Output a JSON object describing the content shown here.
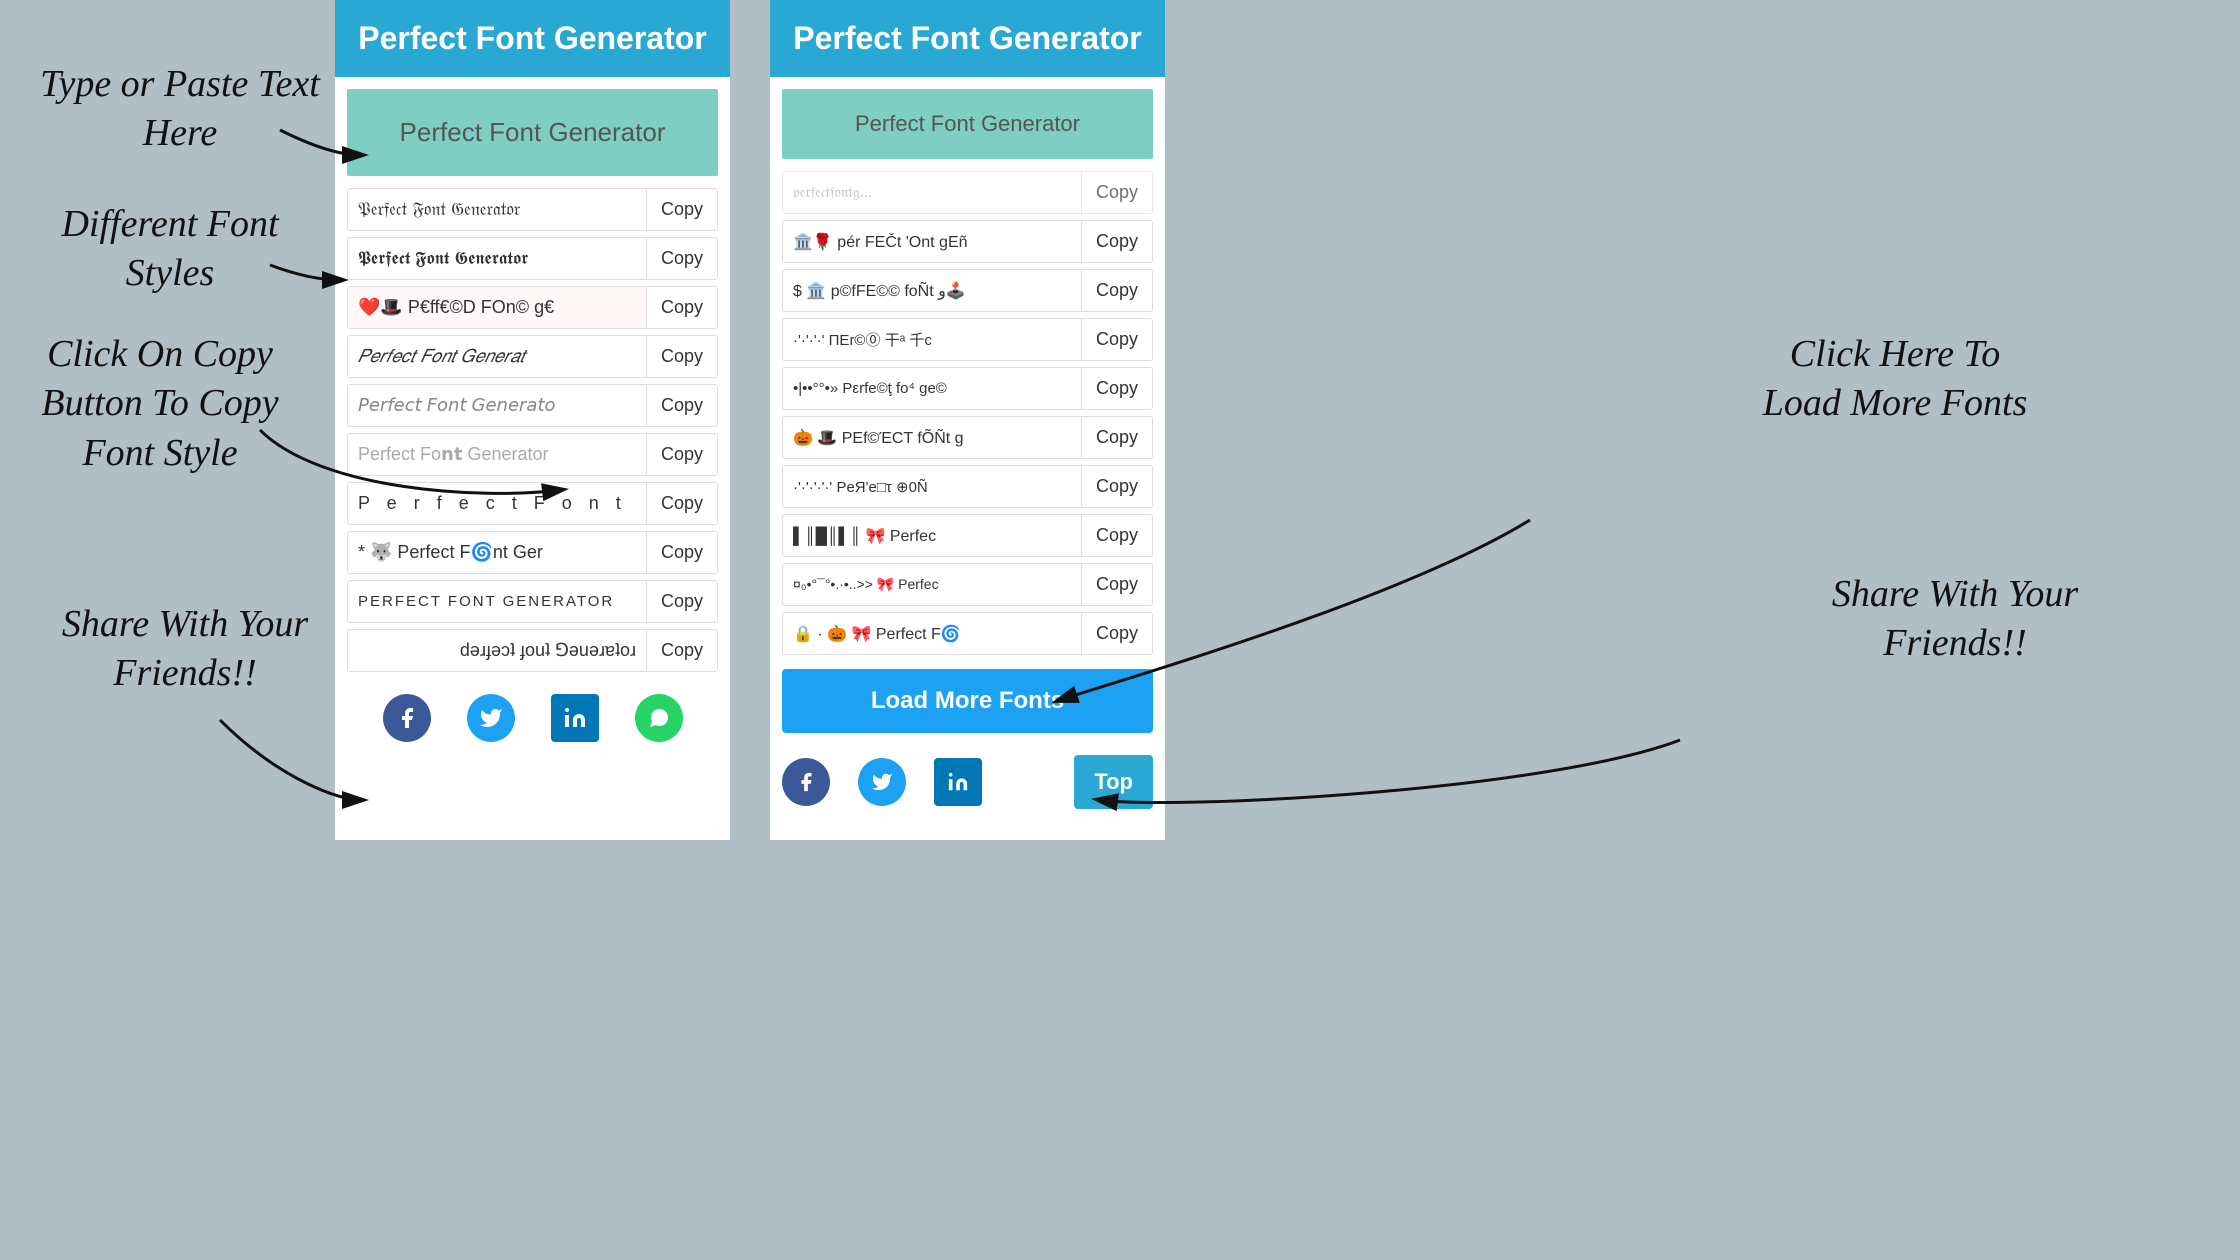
{
  "app": {
    "title": "Perfect Font Generator"
  },
  "annotations": {
    "type_paste": "Type or Paste Text\nHere",
    "diff_fonts": "Different Font\nStyles",
    "click_copy": "Click On Copy\nButton To Copy\nFont Style",
    "share": "Share With\nYour\nFriends!!",
    "load_more_label": "Click Here To\nLoad More\nFonts",
    "share_right": "Share With\nYour\nFriends!!"
  },
  "left_panel": {
    "header": "Perfect Font Generator",
    "input_placeholder": "Perfect Font Generator",
    "font_rows": [
      {
        "text": "𝔓𝔢𝔯𝔣𝔢𝔠𝔱 𝔉𝔬𝔫𝔱 𝔊𝔢𝔫𝔢𝔯𝔞𝔱𝔬𝔯",
        "copy": "Copy"
      },
      {
        "text": "𝕻𝖊𝖗𝖋𝖊𝖈𝖙 𝕱𝖔𝖓𝖙 𝕲𝖊𝖓𝖊𝖗𝖆𝖙𝖔𝖗",
        "copy": "Copy"
      },
      {
        "text": "❤️🎩 P€ff€©D FOn© g€",
        "copy": "Copy"
      },
      {
        "text": "𝑃𝑒𝑟𝑓𝑒𝑐𝑡 𝐹𝑜𝑛𝑡 𝐺𝑒𝑛𝑒𝑟𝑎𝑡",
        "copy": "Copy"
      },
      {
        "text": "𝘗𝘦𝘳𝘧𝘦𝘤𝘵 𝘍𝘰𝘯𝘵 𝘎𝘦𝘯𝘦𝘳𝘢𝘵𝘰",
        "copy": "Copy"
      },
      {
        "text": "Perfect Fo𝗻𝘁 Generator",
        "copy": "Copy"
      },
      {
        "text": "P e r f e c t  F o n t",
        "copy": "Copy"
      },
      {
        "text": "* 🐺 Perfect F🌀nt Ger",
        "copy": "Copy"
      },
      {
        "text": "PERFECT FONT GENERATOR",
        "copy": "Copy"
      },
      {
        "text": "ɹoʇɐɹǝuǝ⅁ ʇuoɟ ʇɔǝɟɹǝd",
        "copy": "Copy"
      }
    ],
    "social": [
      "facebook",
      "twitter",
      "linkedin",
      "whatsapp"
    ]
  },
  "right_panel": {
    "header": "Perfect Font Generator",
    "input_placeholder": "Perfect Font Generator",
    "font_rows": [
      {
        "text": "𝔭𝔢𝔯𝔣𝔢𝔠𝔱 𝔣𝔬𝔫𝔱 𝔤...",
        "copy": "Copy"
      },
      {
        "text": "🏛️🌹 pér FEČt 'Ont gEñ",
        "copy": "Copy"
      },
      {
        "text": "$ 🏛️ p©fFE©© foÑt ﻭ🕹️",
        "copy": "Copy"
      },
      {
        "text": "·'·'·'·' ΠΕr©⓪ 干ᵃ 千c",
        "copy": "Copy"
      },
      {
        "text": "•|••°°•» Ρεrfe©ţ fo⁴ ge©",
        "copy": "Copy"
      },
      {
        "text": "🎃 🎩 ΡΕf©ΈCT fÕÑt g",
        "copy": "Copy"
      },
      {
        "text": "·'·'·'·'·' PeЯ'е□τ ⊕0Ñ",
        "copy": "Copy"
      },
      {
        "text": "▌║█║▌║ 🎀 Perfec",
        "copy": "Copy"
      },
      {
        "text": "¤₀•°¯°•.·•..>> 🎀 Perfec",
        "copy": "Copy"
      },
      {
        "text": "🔒 · 🎃 🎀 Perfect F🌀",
        "copy": "Copy"
      }
    ],
    "load_more": "Load More Fonts",
    "top_btn": "Top",
    "social": [
      "facebook",
      "twitter",
      "linkedin"
    ]
  },
  "icons": {
    "facebook": "f",
    "twitter": "t",
    "linkedin": "in",
    "whatsapp": "w"
  }
}
